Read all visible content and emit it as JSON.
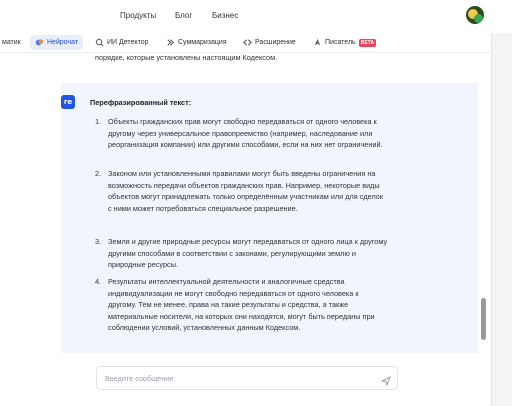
{
  "topnav": {
    "links": [
      "Продукты",
      "Блог",
      "Бизнес"
    ]
  },
  "tabs": [
    {
      "label": "матик",
      "icon": ""
    },
    {
      "label": "Нейрочат",
      "icon": "neurochat-icon",
      "active": true
    },
    {
      "label": "ИИ Детектор",
      "icon": "ai-detector-icon"
    },
    {
      "label": "Суммаризация",
      "icon": "summarize-icon"
    },
    {
      "label": "Расширение",
      "icon": "extension-icon"
    },
    {
      "label": "Писатель",
      "icon": "writer-icon",
      "badge": "BETA"
    }
  ],
  "chat": {
    "previous_tail": "порядке, которые установлены настоящим Кодексом.",
    "logo_text": "re",
    "answer_title": "Перефразированный текст:",
    "items": [
      {
        "num": "1.",
        "text": "Объекты гражданских прав могут свободно передаваться от одного человека к другому через универсальное правопреемство (например, наследование или реорганизация компании) или другими способами, если на них нет ограничений."
      },
      {
        "num": "2.",
        "text": "Законом или установленными правилами могут быть введены ограничения на возможность передачи объектов гражданских прав. Например, некоторые виды объектов могут принадлежать только определённым участникам или для сделок с ними может потребоваться специальное разрешение."
      },
      {
        "num": "3.",
        "text": "Земля и другие природные ресурсы могут передаваться от одного лица к другому другими способами в соответствии с законами, регулирующими землю и природные ресурсы."
      },
      {
        "num": "4.",
        "text": "Результаты интеллектуальной деятельности и аналогичные средства индивидуализации не могут свободно передаваться от одного человека к другому. Тем не менее, права на такие результаты и средства, а также материальные носители, на которых они находятся, могут быть переданы при соблюдении условий, установленных данным Кодексом."
      }
    ]
  },
  "composer": {
    "placeholder": "Введите сообщение",
    "value": ""
  }
}
